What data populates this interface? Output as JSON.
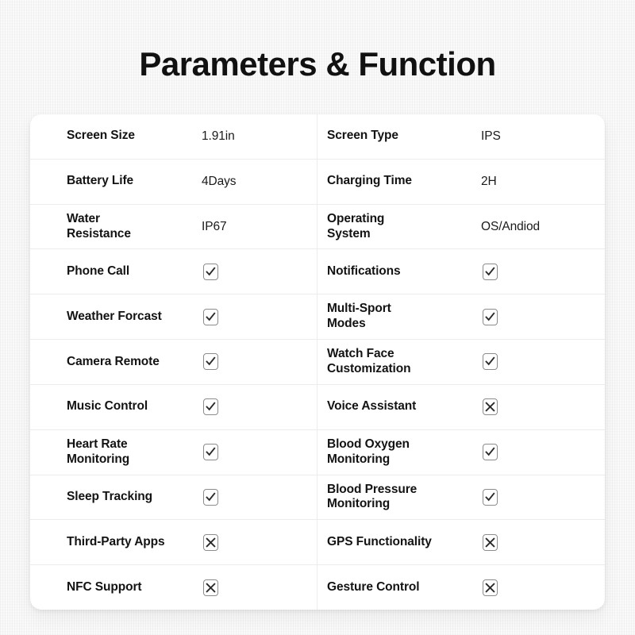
{
  "page": {
    "title": "Parameters & Function",
    "background_color": "#f2f2f2",
    "card_color": "#ffffff",
    "text_color": "#131313",
    "divider_color": "#ececec",
    "mark_border_color": "#8c8c8c",
    "mark_glyph_color": "#2b2b2b"
  },
  "table": {
    "rows": [
      {
        "left": {
          "label": "Screen Size",
          "type": "text",
          "value": "1.91in"
        },
        "right": {
          "label": "Screen Type",
          "type": "text",
          "value": "IPS"
        }
      },
      {
        "left": {
          "label": "Battery Life",
          "type": "text",
          "value": "4Days"
        },
        "right": {
          "label": "Charging Time",
          "type": "text",
          "value": "2H"
        }
      },
      {
        "left": {
          "label": "Water\nResistance",
          "type": "text",
          "value": "IP67"
        },
        "right": {
          "label": "Operating\nSystem",
          "type": "text",
          "value": "OS/Andiod"
        }
      },
      {
        "left": {
          "label": "Phone Call",
          "type": "mark",
          "value": "check"
        },
        "right": {
          "label": "Notifications",
          "type": "mark",
          "value": "check"
        }
      },
      {
        "left": {
          "label": "Weather Forcast",
          "type": "mark",
          "value": "check"
        },
        "right": {
          "label": "Multi-Sport\nModes",
          "type": "mark",
          "value": "check"
        }
      },
      {
        "left": {
          "label": "Camera Remote",
          "type": "mark",
          "value": "check"
        },
        "right": {
          "label": "Watch Face\nCustomization",
          "type": "mark",
          "value": "check"
        }
      },
      {
        "left": {
          "label": "Music Control",
          "type": "mark",
          "value": "check"
        },
        "right": {
          "label": "Voice Assistant",
          "type": "mark",
          "value": "cross"
        }
      },
      {
        "left": {
          "label": "Heart Rate\nMonitoring",
          "type": "mark",
          "value": "check"
        },
        "right": {
          "label": "Blood Oxygen\nMonitoring",
          "type": "mark",
          "value": "check"
        }
      },
      {
        "left": {
          "label": "Sleep Tracking",
          "type": "mark",
          "value": "check"
        },
        "right": {
          "label": "Blood Pressure\nMonitoring",
          "type": "mark",
          "value": "check"
        }
      },
      {
        "left": {
          "label": "Third-Party Apps",
          "type": "mark",
          "value": "cross"
        },
        "right": {
          "label": "GPS Functionality",
          "type": "mark",
          "value": "cross"
        }
      },
      {
        "left": {
          "label": "NFC Support",
          "type": "mark",
          "value": "cross"
        },
        "right": {
          "label": "Gesture Control",
          "type": "mark",
          "value": "cross"
        }
      }
    ]
  }
}
